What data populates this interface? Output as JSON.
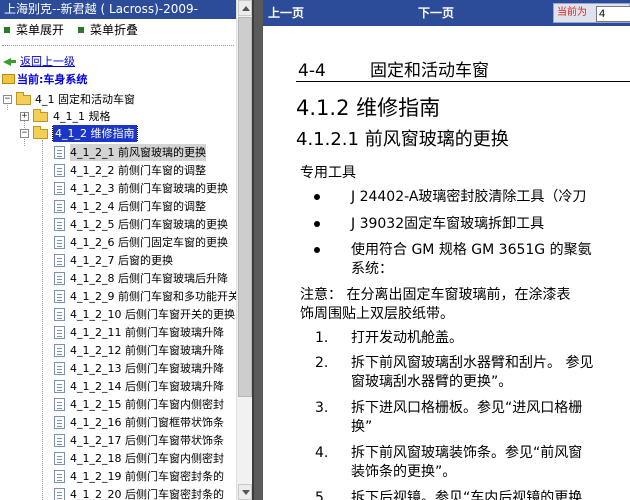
{
  "left_panel": {
    "title": "上海别克--新君越 ( Lacross)-2009-",
    "menu": {
      "expand": "菜单展开",
      "collapse": "菜单折叠"
    },
    "back_link": "返回上一级",
    "current_label": "当前:车身系统",
    "tree": {
      "l1": "4_1 固定和活动车窗",
      "l2_a": "4_1_1 规格",
      "l2_b": "4_1_2 维修指南",
      "items": [
        "4_1_2_1 前风窗玻璃的更换",
        "4_1_2_2 前侧门车窗的调整",
        "4_1_2_3 前侧门车窗玻璃的更换",
        "4_1_2_4 后侧门车窗的调整",
        "4_1_2_5 后侧门车窗玻璃的更换",
        "4_1_2_6 后侧门固定车窗的更换",
        "4_1_2_7 后窗的更换",
        "4_1_2_8 后侧门车窗玻璃后升降",
        "4_1_2_9 前侧门车窗和多功能开关",
        "4_1_2_10 后侧门车窗开关的更换",
        "4_1_2_11 前侧门车窗玻璃升降",
        "4_1_2_12 前侧门车窗玻璃升降",
        "4_1_2_13 后侧门车窗玻璃升降",
        "4_1_2_14 后侧门车窗玻璃升降",
        "4_1_2_15 前侧门车窗内侧密封",
        "4_1_2_16 前侧门窗框带状饰条",
        "4_1_2_17 后侧门车窗带状饰条",
        "4_1_2_18 后侧门车窗内侧密封",
        "4_1_2_19 前侧门车窗密封条的",
        "4_1_2_20 后侧门车窗密封条的"
      ]
    }
  },
  "top_bar": {
    "prev": "上一页",
    "next": "下一页",
    "current_page_label": "当前为",
    "current_page_value": "4"
  },
  "document": {
    "section_number": "4-4",
    "section_title": "固定和活动车窗",
    "heading_412": "4.1.2 维修指南",
    "heading_4121": "4.1.2.1 前风窗玻璃的更换",
    "special_tools_label": "专用工具",
    "tools": [
      "J 24402-A玻璃密封胶清除工具（冷刀",
      "J 39032固定车窗玻璃拆卸工具",
      "使用符合 GM 规格 GM 3651G 的聚氨"
    ],
    "tool3_cont": "系统：",
    "note_line1": "注意：  在分离出固定车窗玻璃前，在涂漆表",
    "note_line2": "饰周围贴上双层胶纸带。",
    "steps": [
      {
        "num": "1.",
        "line1": "打开发动机舱盖。",
        "line2": ""
      },
      {
        "num": "2.",
        "line1": "拆下前风窗玻璃刮水器臂和刮片。 参见",
        "line2": "窗玻璃刮水器臂的更换”。"
      },
      {
        "num": "3.",
        "line1": "拆下进风口格栅板。参见“进风口格栅",
        "line2": "换”"
      },
      {
        "num": "4.",
        "line1": "拆下前风窗玻璃装饰条。参见“前风窗",
        "line2": "装饰条的更换”。"
      },
      {
        "num": "5.",
        "line1": "拆下后视镜。参见“车内后视镜的更换",
        "line2": ""
      }
    ]
  },
  "colors": {
    "title_bar": "#2c4b99",
    "selected": "#1b35c6",
    "splitter": "#5a5a5a",
    "current_page_label": "#e0201a"
  }
}
